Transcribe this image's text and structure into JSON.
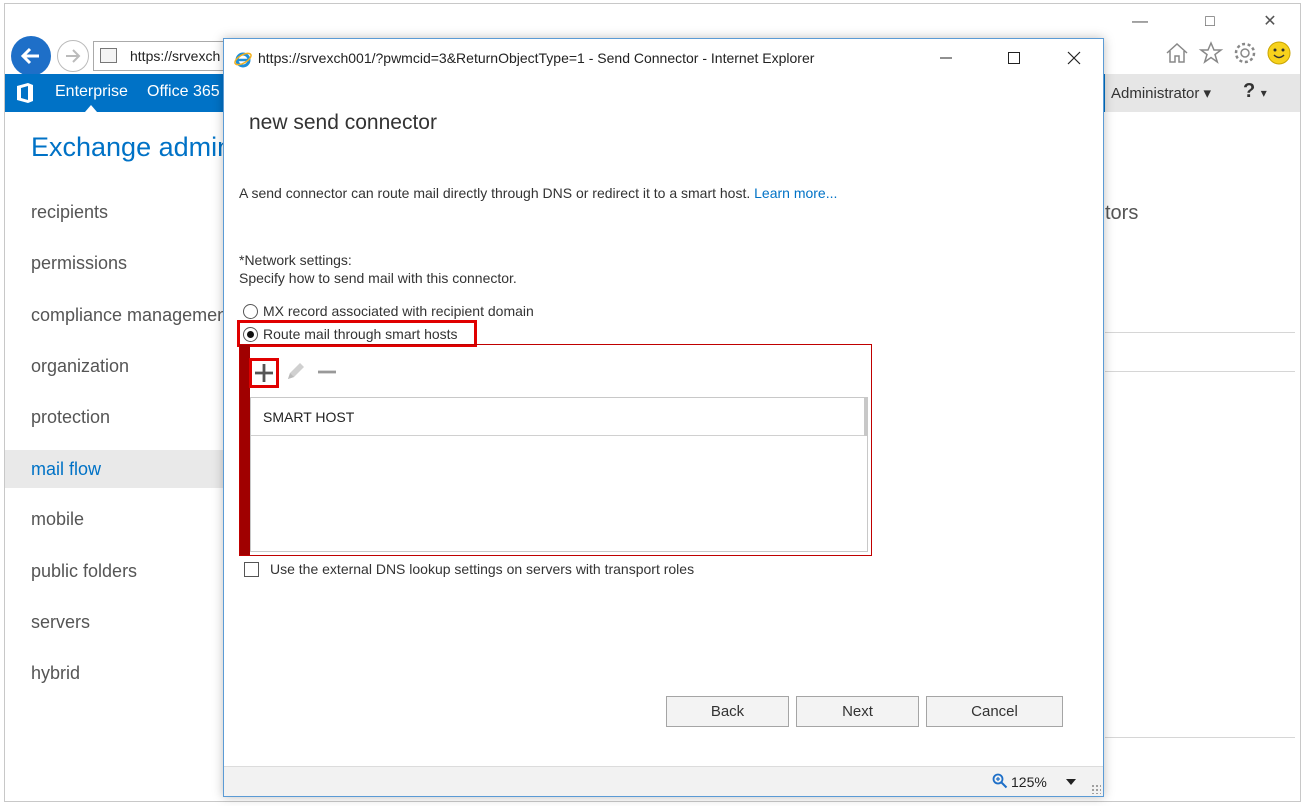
{
  "background_window": {
    "address_url": "https://srvexch",
    "nav_bar": {
      "links": [
        "Enterprise",
        "Office 365"
      ],
      "user": "Administrator",
      "help": "?"
    },
    "app_title": "Exchange admin",
    "sidebar": {
      "items": [
        "recipients",
        "permissions",
        "compliance management",
        "organization",
        "protection",
        "mail flow",
        "mobile",
        "public folders",
        "servers",
        "hybrid"
      ],
      "active": "mail flow"
    },
    "content_fragment": "tors"
  },
  "popup": {
    "window_title": "https://srvexch001/?pwmcid=3&ReturnObjectType=1 - Send Connector - Internet Explorer",
    "heading": "new send connector",
    "description": "A send connector can route mail directly through DNS or redirect it to a smart host.",
    "learn_more": "Learn more...",
    "network_label": "*Network settings:",
    "network_hint": "Specify how to send mail with this connector.",
    "radio_options": [
      {
        "label": "MX record associated with recipient domain",
        "checked": false
      },
      {
        "label": "Route mail through smart hosts",
        "checked": true
      }
    ],
    "smart_hosts": {
      "toolbar": [
        "add-icon",
        "edit-icon",
        "remove-icon"
      ],
      "column_header": "SMART HOST",
      "rows": []
    },
    "dns_checkbox": {
      "label": "Use the external DNS lookup settings on servers with transport roles",
      "checked": false
    },
    "buttons": {
      "back": "Back",
      "next": "Next",
      "cancel": "Cancel"
    },
    "zoom": "125%"
  },
  "colors": {
    "accent_blue": "#0072c6",
    "highlight_red": "#e00000"
  }
}
